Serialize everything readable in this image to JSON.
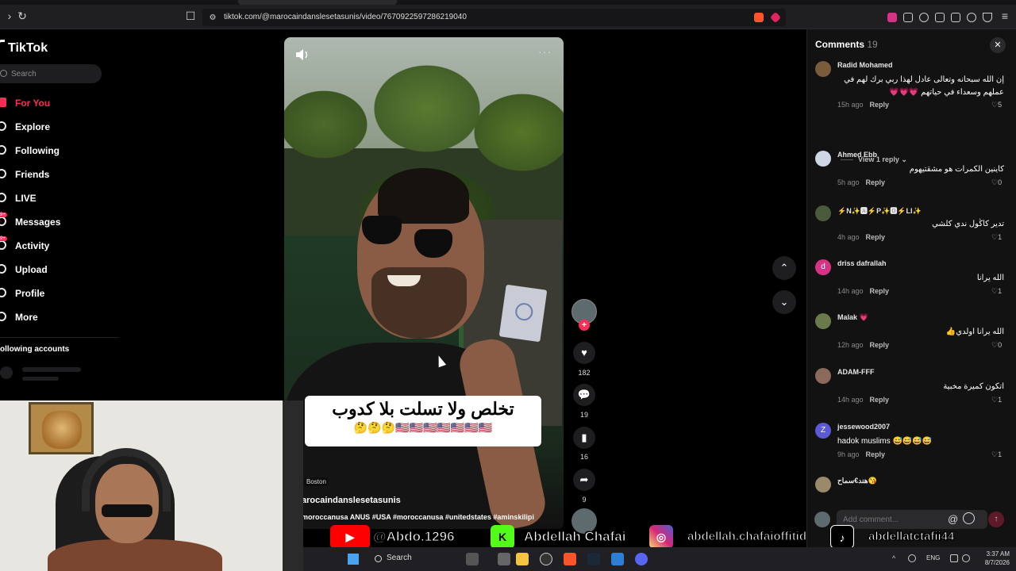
{
  "browser": {
    "url": "tiktok.com/@marocaindanslesetasunis/video/7670922597286219040"
  },
  "sidebar": {
    "logo": "TikTok",
    "search_placeholder": "Search",
    "items": [
      {
        "label": "For You",
        "icon": "home-icon",
        "active": true
      },
      {
        "label": "Explore",
        "icon": "compass-icon"
      },
      {
        "label": "Following",
        "icon": "following-icon"
      },
      {
        "label": "Friends",
        "icon": "friends-icon"
      },
      {
        "label": "LIVE",
        "icon": "live-icon"
      },
      {
        "label": "Messages",
        "icon": "messages-icon",
        "badge": "9+"
      },
      {
        "label": "Activity",
        "icon": "activity-icon",
        "badge": "9+"
      },
      {
        "label": "Upload",
        "icon": "upload-icon"
      },
      {
        "label": "Profile",
        "icon": "profile-icon"
      },
      {
        "label": "More",
        "icon": "more-icon"
      }
    ],
    "following_title": "ollowing accounts"
  },
  "video": {
    "caption_line1": "تخلص ولا تسلت بلا كدوب",
    "caption_line2": "🤔🤔🤔🇺🇸🇺🇸🇺🇸🇺🇸🇺🇸🇺🇸🇺🇸",
    "location": "Boston",
    "author": "arocaindanslesetasunis",
    "hashtags": "moroccanusa ANUS #USA #moroccanusa #unitedstates #aminskilipi"
  },
  "actions": {
    "likes": "182",
    "comments": "19",
    "saves": "16",
    "shares": "9"
  },
  "comments": {
    "title": "Comments",
    "count": "19",
    "input_placeholder": "Add comment...",
    "view_replies": "View 1 reply",
    "items": [
      {
        "user": "Radid Mohamed",
        "text": "إن الله سبحانه وتعالى عادل لهذا ربي برك لهم في عملهم وسعداء في حياتهم 💗💗💗",
        "time": "15h ago",
        "reply": "Reply",
        "likes": "5"
      },
      {
        "user": "Ahmed Ebb",
        "text": "كاينين الكمرات هو مشقتيهوم",
        "time": "5h ago",
        "reply": "Reply",
        "likes": "0"
      },
      {
        "user": "⚡N✨🅰⚡P✨🅾⚡LI✨",
        "text": "تدير كاڭول ندي كلشي",
        "time": "4h ago",
        "reply": "Reply",
        "likes": "1"
      },
      {
        "user": "driss dafrallah",
        "text": "الله يرانا",
        "time": "14h ago",
        "reply": "Reply",
        "likes": "1",
        "initial": "d"
      },
      {
        "user": "Malak 💗",
        "text": "الله يرانا اولدي👍",
        "time": "12h ago",
        "reply": "Reply",
        "likes": "0"
      },
      {
        "user": "ADAM-FFF",
        "text": "اتكون كميرة مخبية",
        "time": "14h ago",
        "reply": "Reply",
        "likes": "1"
      },
      {
        "user": "jessewood2007",
        "text": "hadok muslims 😅😅😅😅",
        "time": "9h ago",
        "reply": "Reply",
        "likes": "1",
        "initial": "Z"
      },
      {
        "user": "هند€سماح😘",
        "text": "",
        "time": "",
        "reply": "",
        "likes": ""
      }
    ]
  },
  "social": {
    "youtube": "@Abdo.1296",
    "kick": "Abdellah Chafai",
    "instagram": "abdellah.chafaioffitid",
    "tiktok": "abdellatctafii44"
  },
  "taskbar": {
    "search": "Search",
    "lang": "ENG",
    "time": "3:37 AM",
    "date": "8/7/2026"
  },
  "colors": {
    "accent": "#fe2c55",
    "background": "#000000",
    "panel": "#121212"
  }
}
